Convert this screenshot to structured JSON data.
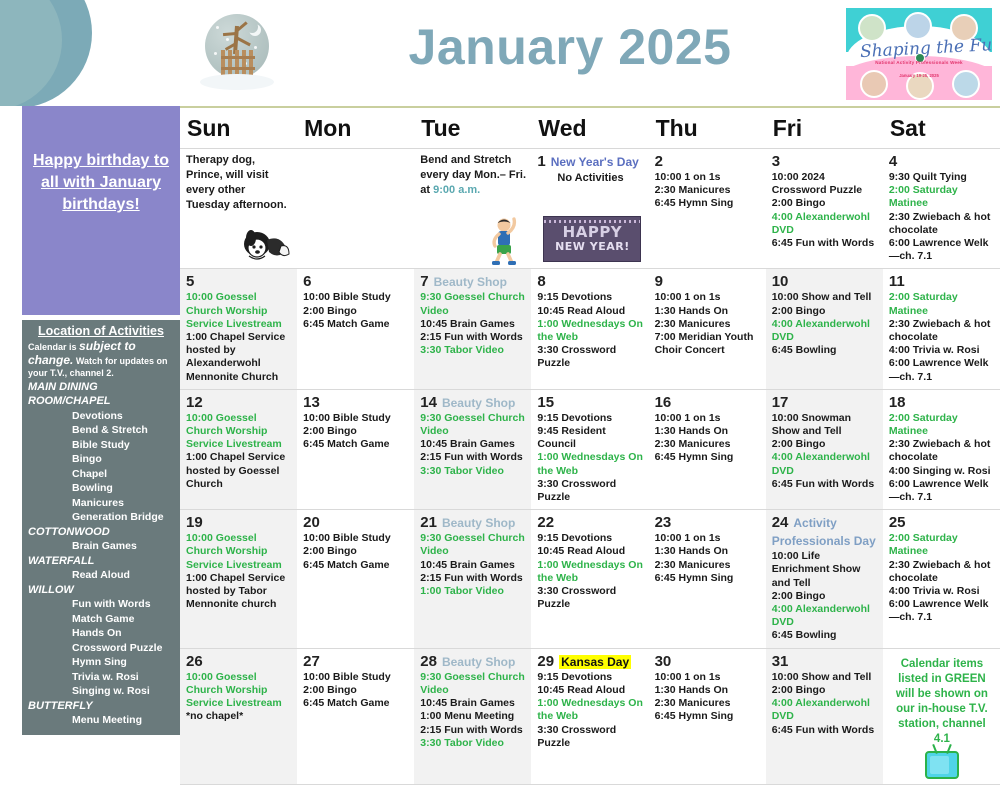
{
  "header": {
    "month_title": "January 2025",
    "snowglobe_icon": "snow-globe-icon",
    "logo": {
      "script": "Shaping the Future",
      "line1": "National Activity Professionals Week",
      "line2": "January 19-25, 2025"
    }
  },
  "sidebar": {
    "birthday_note": "Happy birthday to all with January birthdays!",
    "location": {
      "title": "Location of Activities",
      "note_pre": "Calendar is ",
      "note_em1": "subject to change.",
      "note_post": " Watch for updates on your T.V., channel 2.",
      "sections": [
        {
          "name": "MAIN DINING ROOM/CHAPEL",
          "items": [
            "Devotions",
            "Bend & Stretch",
            "Bible Study",
            "Bingo",
            "Chapel",
            "Bowling",
            "Manicures",
            "Generation Bridge"
          ]
        },
        {
          "name": "COTTONWOOD",
          "items": [
            "Brain Games"
          ]
        },
        {
          "name": "WATERFALL",
          "items": [
            "Read Aloud"
          ]
        },
        {
          "name": "WILLOW",
          "items": [
            "Fun with Words",
            "Match Game",
            "Hands On",
            "Crossword Puzzle",
            "Hymn Sing",
            "Trivia w. Rosi",
            "Singing w. Rosi"
          ]
        },
        {
          "name": "BUTTERFLY",
          "items": [
            "Menu Meeting"
          ]
        }
      ]
    }
  },
  "calendar": {
    "dow": [
      "Sun",
      "Mon",
      "Tue",
      "Wed",
      "Thu",
      "Fri",
      "Sat"
    ],
    "green_legend": "Calendar items listed in GREEN will be shown on our in-house T.V. station, channel 4.1",
    "notes": {
      "therapy_dog": "Therapy dog, Prince, will visit every other Tuesday afternoon.",
      "bend_stretch_1": "Bend and Stretch every day Mon.– Fri. at ",
      "bend_stretch_time": "9:00 a.m.",
      "new_year_banner_1": "HAPPY",
      "new_year_banner_2": "NEW YEAR!"
    },
    "weeks": [
      [
        {
          "type": "note",
          "kind": "therapy-dog"
        },
        {
          "type": "empty"
        },
        {
          "type": "note",
          "kind": "bend-stretch"
        },
        {
          "day": "1",
          "flag": "New Year's Day",
          "flag_style": "ny",
          "subtitle": "No Activities",
          "events": [],
          "banner": true
        },
        {
          "day": "2",
          "events": [
            {
              "t": "10:00 1 on 1s",
              "g": false
            },
            {
              "t": "2:30 Manicures",
              "g": false
            },
            {
              "t": "6:45 Hymn Sing",
              "g": false
            }
          ]
        },
        {
          "day": "3",
          "events": [
            {
              "t": "10:00 2024 Crossword Puzzle",
              "g": false
            },
            {
              "t": "2:00 Bingo",
              "g": false
            },
            {
              "t": "4:00 Alexanderwohl DVD",
              "g": true
            },
            {
              "t": "6:45 Fun with Words",
              "g": false
            }
          ]
        },
        {
          "day": "4",
          "events": [
            {
              "t": "9:30 Quilt Tying",
              "g": false
            },
            {
              "t": "2:00 Saturday Matinee",
              "g": true
            },
            {
              "t": "2:30 Zwiebach & hot chocolate",
              "g": false
            },
            {
              "t": "6:00 Lawrence Welk—ch. 7.1",
              "g": false
            }
          ]
        }
      ],
      [
        {
          "day": "5",
          "shade": true,
          "events": [
            {
              "t": "10:00 Goessel Church Worship Service Livestream",
              "g": true
            },
            {
              "t": "1:00 Chapel Service hosted by Alexanderwohl Mennonite Church",
              "g": false
            }
          ]
        },
        {
          "day": "6",
          "events": [
            {
              "t": "10:00 Bible Study",
              "g": false
            },
            {
              "t": "2:00 Bingo",
              "g": false
            },
            {
              "t": "6:45 Match Game",
              "g": false
            }
          ]
        },
        {
          "day": "7",
          "shade": true,
          "flag": "Beauty Shop",
          "events": [
            {
              "t": "9:30 Goessel Church Video",
              "g": true
            },
            {
              "t": "10:45 Brain Games",
              "g": false
            },
            {
              "t": "2:15 Fun with Words",
              "g": false
            },
            {
              "t": "3:30 Tabor Video",
              "g": true
            }
          ]
        },
        {
          "day": "8",
          "events": [
            {
              "t": "9:15 Devotions",
              "g": false
            },
            {
              "t": "10:45 Read Aloud",
              "g": false
            },
            {
              "t": "1:00 Wednesdays On the Web",
              "g": true
            },
            {
              "t": "3:30 Crossword Puzzle",
              "g": false
            }
          ]
        },
        {
          "day": "9",
          "events": [
            {
              "t": "10:00 1 on 1s",
              "g": false
            },
            {
              "t": "1:30 Hands On",
              "g": false
            },
            {
              "t": "2:30 Manicures",
              "g": false
            },
            {
              "t": "7:00 Meridian Youth Choir Concert",
              "g": false
            }
          ]
        },
        {
          "day": "10",
          "shade": true,
          "events": [
            {
              "t": "10:00 Show and Tell",
              "g": false
            },
            {
              "t": "2:00 Bingo",
              "g": false
            },
            {
              "t": "4:00 Alexanderwohl DVD",
              "g": true
            },
            {
              "t": "6:45 Bowling",
              "g": false
            }
          ]
        },
        {
          "day": "11",
          "events": [
            {
              "t": "2:00 Saturday Matinee",
              "g": true
            },
            {
              "t": "2:30 Zwiebach & hot chocolate",
              "g": false
            },
            {
              "t": "4:00 Trivia w. Rosi",
              "g": false
            },
            {
              "t": "6:00 Lawrence Welk—ch. 7.1",
              "g": false
            }
          ]
        }
      ],
      [
        {
          "day": "12",
          "shade": true,
          "events": [
            {
              "t": "10:00 Goessel Church Worship Service Livestream",
              "g": true
            },
            {
              "t": "1:00 Chapel Service hosted by Goessel Church",
              "g": false
            }
          ]
        },
        {
          "day": "13",
          "events": [
            {
              "t": "10:00 Bible Study",
              "g": false
            },
            {
              "t": "2:00 Bingo",
              "g": false
            },
            {
              "t": "6:45 Match Game",
              "g": false
            }
          ]
        },
        {
          "day": "14",
          "shade": true,
          "flag": "Beauty Shop",
          "events": [
            {
              "t": "9:30 Goessel Church Video",
              "g": true
            },
            {
              "t": "10:45 Brain Games",
              "g": false
            },
            {
              "t": "2:15 Fun with Words",
              "g": false
            },
            {
              "t": "3:30 Tabor Video",
              "g": true
            }
          ]
        },
        {
          "day": "15",
          "events": [
            {
              "t": "9:15 Devotions",
              "g": false
            },
            {
              "t": "9:45 Resident Council",
              "g": false
            },
            {
              "t": "1:00 Wednesdays On the Web",
              "g": true
            },
            {
              "t": "3:30 Crossword Puzzle",
              "g": false
            }
          ]
        },
        {
          "day": "16",
          "events": [
            {
              "t": "10:00 1 on 1s",
              "g": false
            },
            {
              "t": "1:30 Hands On",
              "g": false
            },
            {
              "t": "2:30 Manicures",
              "g": false
            },
            {
              "t": "6:45 Hymn Sing",
              "g": false
            }
          ]
        },
        {
          "day": "17",
          "shade": true,
          "events": [
            {
              "t": "10:00 Snowman Show and Tell",
              "g": false
            },
            {
              "t": "2:00 Bingo",
              "g": false
            },
            {
              "t": "4:00 Alexanderwohl DVD",
              "g": true
            },
            {
              "t": " 6:45 Fun with Words",
              "g": false
            }
          ]
        },
        {
          "day": "18",
          "events": [
            {
              "t": "2:00 Saturday Matinee",
              "g": true
            },
            {
              "t": "2:30 Zwiebach & hot chocolate",
              "g": false
            },
            {
              "t": "4:00 Singing w. Rosi",
              "g": false
            },
            {
              "t": "6:00 Lawrence Welk—ch. 7.1",
              "g": false
            }
          ]
        }
      ],
      [
        {
          "day": "19",
          "shade": true,
          "events": [
            {
              "t": "10:00 Goessel Church Worship Service Livestream",
              "g": true
            },
            {
              "t": "1:00 Chapel Service hosted by Tabor Mennonite church",
              "g": false
            }
          ]
        },
        {
          "day": "20",
          "events": [
            {
              "t": "10:00 Bible Study",
              "g": false
            },
            {
              "t": "2:00 Bingo",
              "g": false
            },
            {
              "t": "6:45 Match Game",
              "g": false
            }
          ]
        },
        {
          "day": "21",
          "shade": true,
          "flag": "Beauty Shop",
          "events": [
            {
              "t": "9:30 Goessel Church Video",
              "g": true
            },
            {
              "t": "10:45 Brain Games",
              "g": false
            },
            {
              "t": "2:15 Fun with Words",
              "g": false
            },
            {
              "t": "1:00 Tabor Video",
              "g": true
            }
          ]
        },
        {
          "day": "22",
          "events": [
            {
              "t": "9:15 Devotions",
              "g": false
            },
            {
              "t": "10:45 Read Aloud",
              "g": false
            },
            {
              "t": "1:00 Wednesdays On the Web",
              "g": true
            },
            {
              "t": "3:30 Crossword Puzzle",
              "g": false
            }
          ]
        },
        {
          "day": "23",
          "events": [
            {
              "t": "10:00 1 on 1s",
              "g": false
            },
            {
              "t": "1:30 Hands On",
              "g": false
            },
            {
              "t": "2:30 Manicures",
              "g": false
            },
            {
              "t": "6:45 Hymn Sing",
              "g": false
            }
          ]
        },
        {
          "day": "24",
          "shade": true,
          "flag": "Activity Professionals Day",
          "flag_style": "apd",
          "events": [
            {
              "t": "10:00 Life Enrichment Show and Tell",
              "g": false
            },
            {
              "t": "2:00 Bingo",
              "g": false
            },
            {
              "t": "4:00 Alexanderwohl DVD",
              "g": true
            },
            {
              "t": "6:45 Bowling",
              "g": false
            }
          ]
        },
        {
          "day": "25",
          "events": [
            {
              "t": "2:00 Saturday Matinee",
              "g": true
            },
            {
              "t": "2:30 Zwiebach & hot chocolate",
              "g": false
            },
            {
              "t": "4:00 Trivia w. Rosi",
              "g": false
            },
            {
              "t": "6:00 Lawrence Welk—ch. 7.1",
              "g": false
            }
          ]
        }
      ],
      [
        {
          "day": "26",
          "shade": true,
          "events": [
            {
              "t": "10:00 Goessel Church Worship Service Livestream",
              "g": true
            },
            {
              "t": "*no chapel*",
              "g": false
            }
          ]
        },
        {
          "day": "27",
          "events": [
            {
              "t": "10:00 Bible Study",
              "g": false
            },
            {
              "t": "2:00 Bingo",
              "g": false
            },
            {
              "t": "6:45 Match Game",
              "g": false
            }
          ]
        },
        {
          "day": "28",
          "shade": true,
          "flag": "Beauty Shop",
          "events": [
            {
              "t": "9:30 Goessel Church Video",
              "g": true
            },
            {
              "t": "10:45 Brain Games",
              "g": false
            },
            {
              "t": "1:00 Menu Meeting",
              "g": false
            },
            {
              "t": "2:15 Fun with Words",
              "g": false
            },
            {
              "t": "3:30 Tabor Video",
              "g": true
            }
          ]
        },
        {
          "day": "29",
          "flag": "Kansas Day",
          "flag_style": "kansas",
          "events": [
            {
              "t": "9:15 Devotions",
              "g": false
            },
            {
              "t": "10:45 Read Aloud",
              "g": false
            },
            {
              "t": "1:00 Wednesdays On the Web",
              "g": true
            },
            {
              "t": "3:30 Crossword Puzzle",
              "g": false
            }
          ]
        },
        {
          "day": "30",
          "events": [
            {
              "t": "10:00 1 on 1s",
              "g": false
            },
            {
              "t": "1:30 Hands On",
              "g": false
            },
            {
              "t": "2:30 Manicures",
              "g": false
            },
            {
              "t": "6:45 Hymn Sing",
              "g": false
            }
          ]
        },
        {
          "day": "31",
          "shade": true,
          "events": [
            {
              "t": "10:00 Show and Tell",
              "g": false
            },
            {
              "t": "2:00 Bingo",
              "g": false
            },
            {
              "t": "4:00 Alexanderwohl DVD",
              "g": true
            },
            {
              "t": " 6:45 Fun with Words",
              "g": false
            }
          ]
        },
        {
          "type": "legend"
        }
      ]
    ]
  }
}
